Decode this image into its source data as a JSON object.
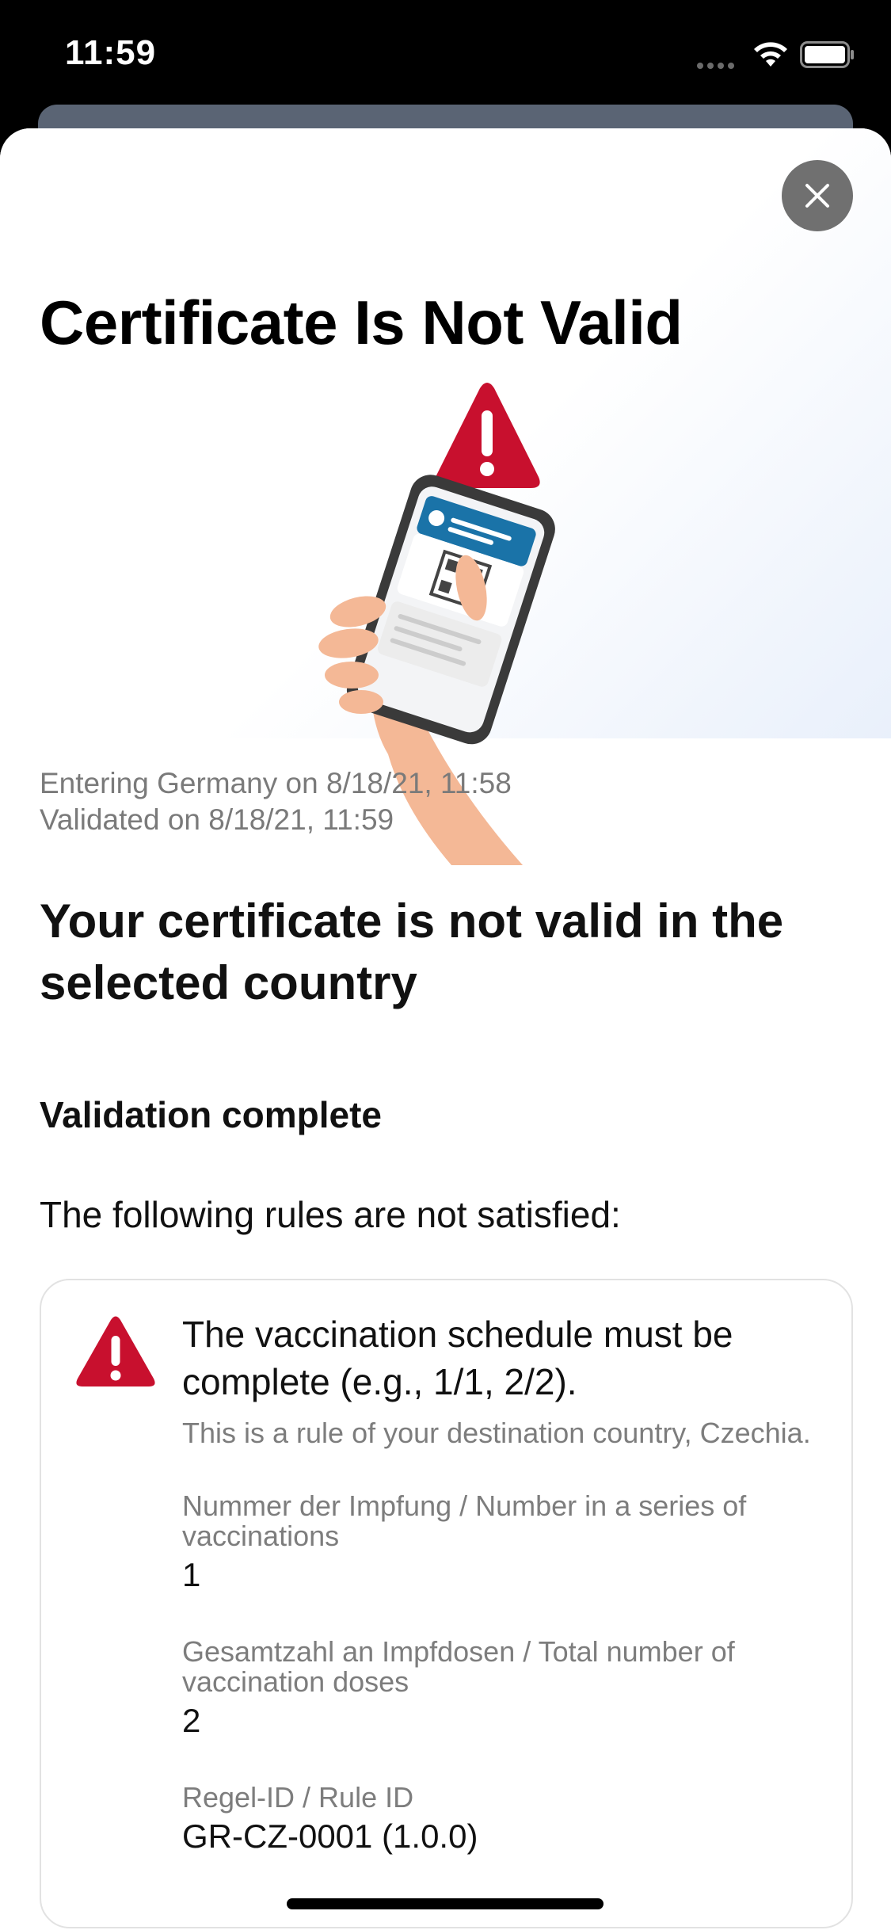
{
  "status_bar": {
    "time": "11:59"
  },
  "header": {
    "title": "Certificate Is Not Valid"
  },
  "meta": {
    "entering": "Entering Germany on 8/18/21, 11:58",
    "validated": "Validated on 8/18/21, 11:59"
  },
  "headline": "Your certificate is not valid in the selected country",
  "subhead": "Validation complete",
  "rules_intro": "The following rules are not satisfied:",
  "rule": {
    "title": "The vaccination schedule must be complete (e.g., 1/1, 2/2).",
    "source": "This is a rule of your destination country, Czechia.",
    "fields": [
      {
        "label": "Nummer der Impfung / Number in a series of vaccinations",
        "value": "1"
      },
      {
        "label": "Gesamtzahl an Impfdosen / Total number of vaccination doses",
        "value": "2"
      },
      {
        "label": "Regel-ID / Rule ID",
        "value": "GR-CZ-0001 (1.0.0)"
      }
    ]
  },
  "colors": {
    "warning_red": "#c8102e",
    "close_gray": "#707070",
    "accent_blue": "#1a73a8",
    "skin": "#f4b896"
  },
  "icons": [
    "signal-icon",
    "wifi-icon",
    "battery-icon",
    "close-icon",
    "warning-icon"
  ]
}
